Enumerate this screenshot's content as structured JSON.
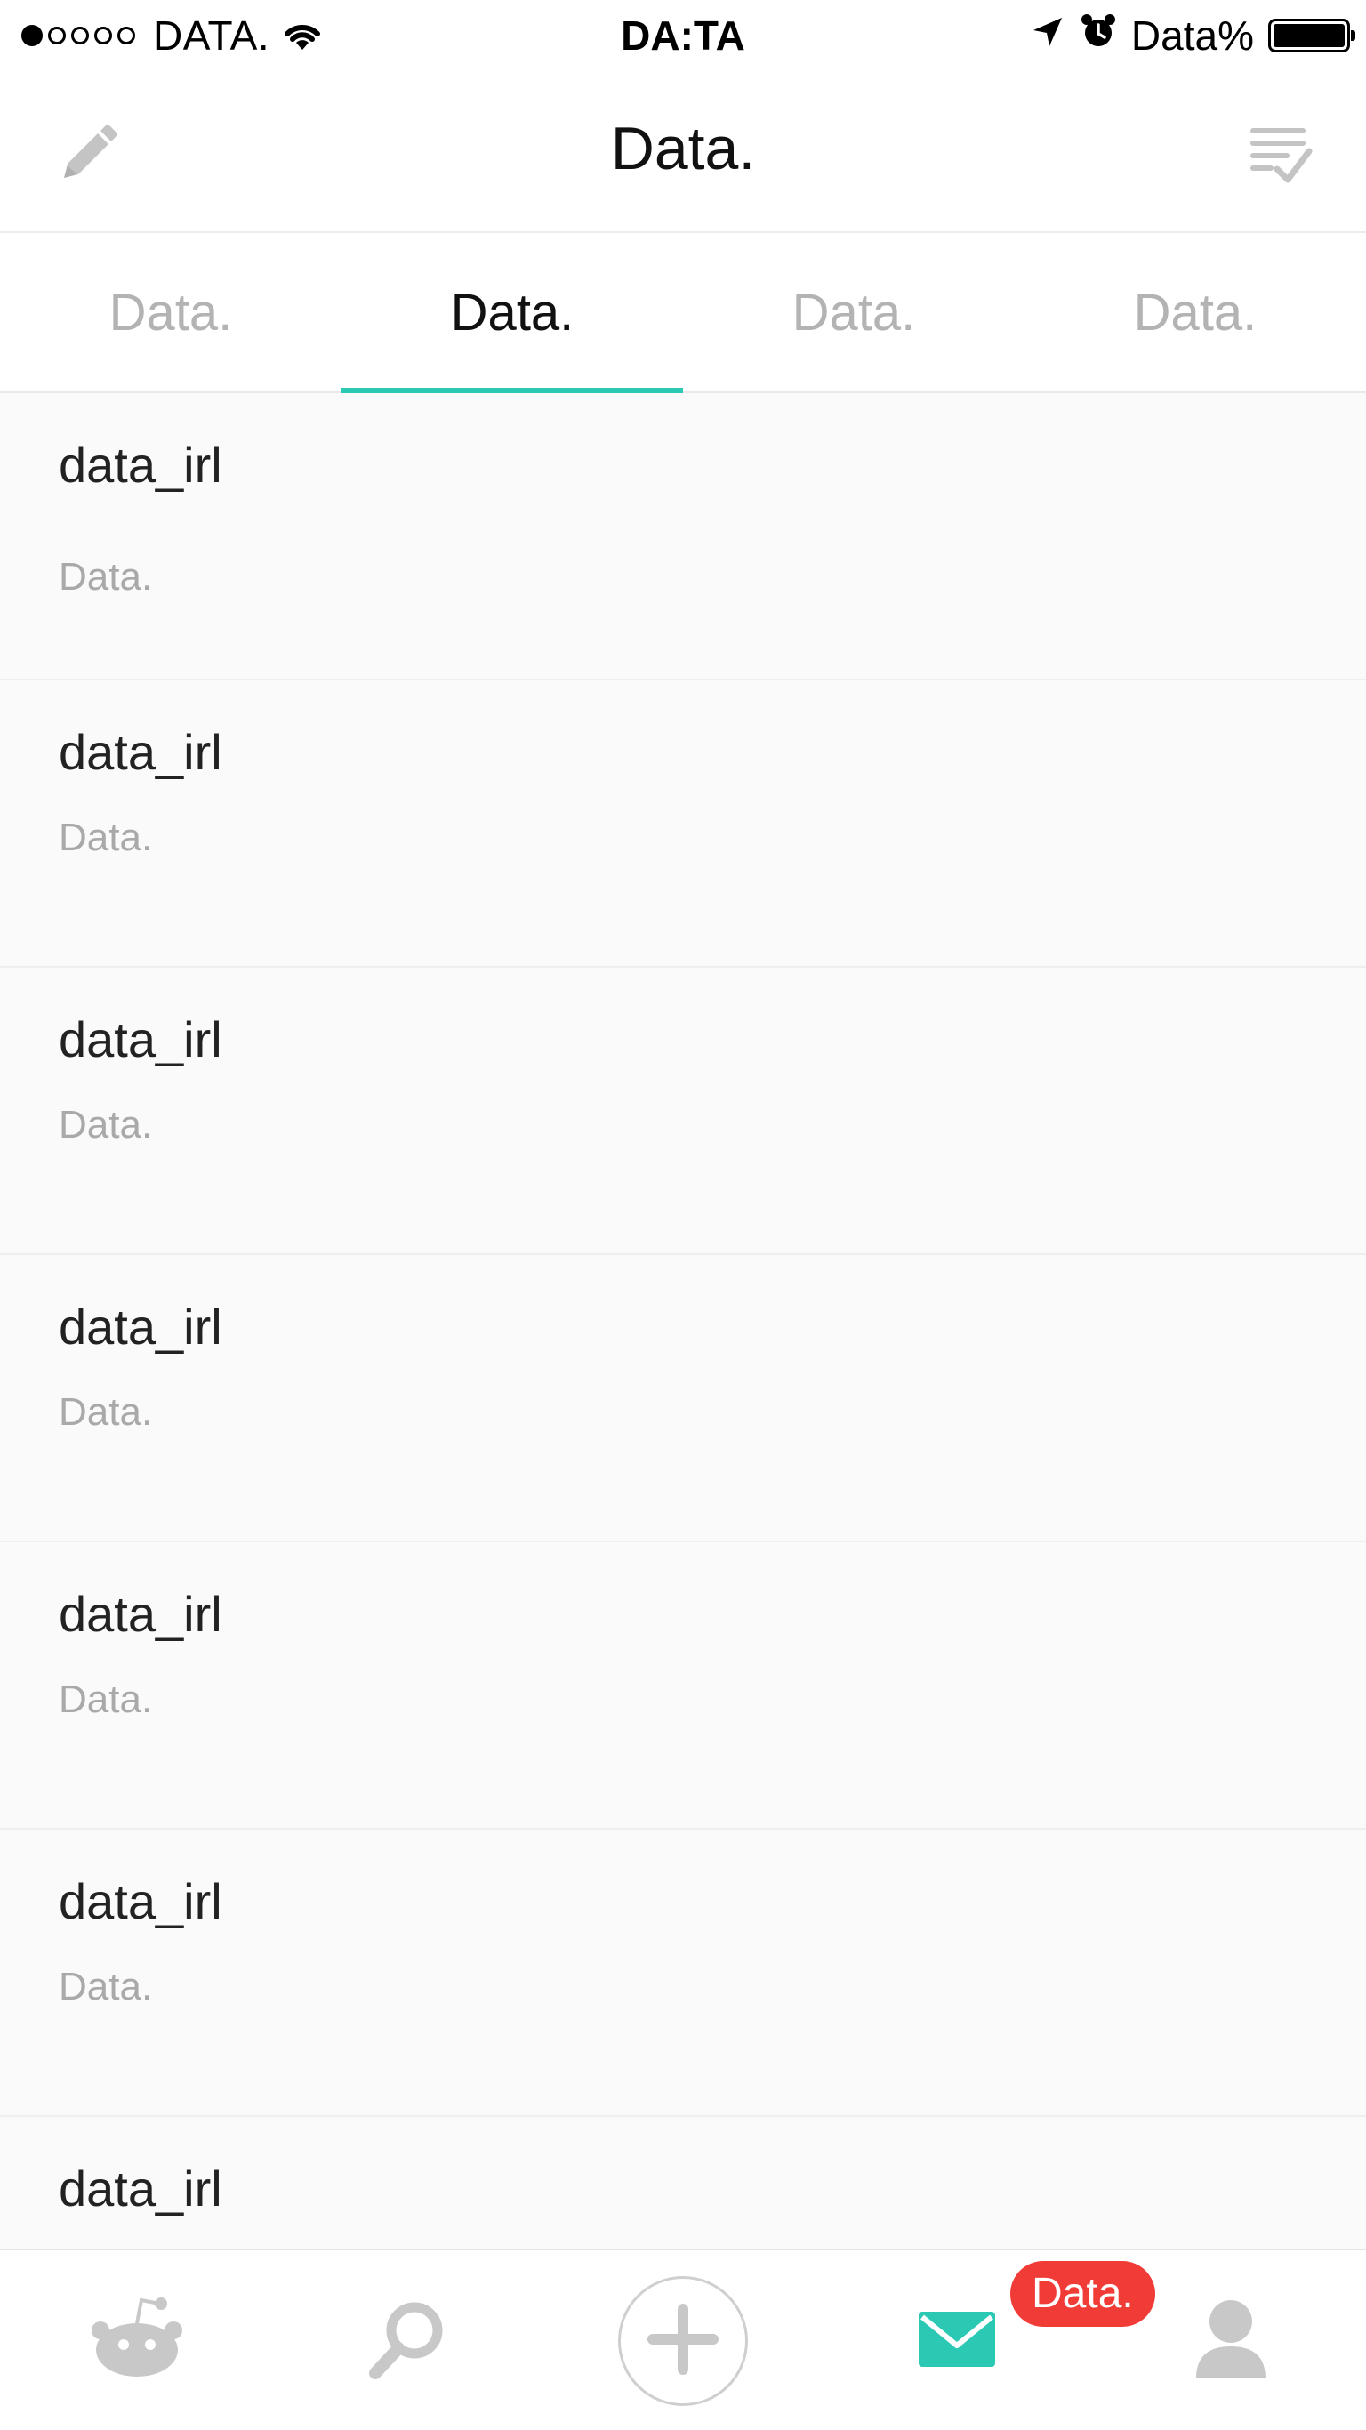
{
  "status_bar": {
    "carrier": "DATA.",
    "time": "DA:TA",
    "battery": "Data%"
  },
  "nav": {
    "title": "Data.",
    "left_icon": "pencil-icon",
    "right_icon": "mark-read-icon"
  },
  "tabs": [
    {
      "label": "Data."
    },
    {
      "label": "Data.",
      "active": true
    },
    {
      "label": "Data."
    },
    {
      "label": "Data."
    }
  ],
  "messages": [
    {
      "title": "data_irl",
      "subtitle": "Data."
    },
    {
      "title": "data_irl",
      "subtitle": "Data."
    },
    {
      "title": "data_irl",
      "subtitle": "Data."
    },
    {
      "title": "data_irl",
      "subtitle": "Data."
    },
    {
      "title": "data_irl",
      "subtitle": "Data."
    },
    {
      "title": "data_irl",
      "subtitle": "Data."
    },
    {
      "title": "data_irl"
    }
  ],
  "bottom_tabs": {
    "items": [
      "home-icon",
      "search-icon",
      "post-icon",
      "inbox-icon",
      "profile-icon"
    ],
    "inbox_badge": "Data."
  },
  "colors": {
    "accent": "#2bc9b4",
    "badge": "#f03b36",
    "icon_inactive": "#c8c8c8"
  }
}
